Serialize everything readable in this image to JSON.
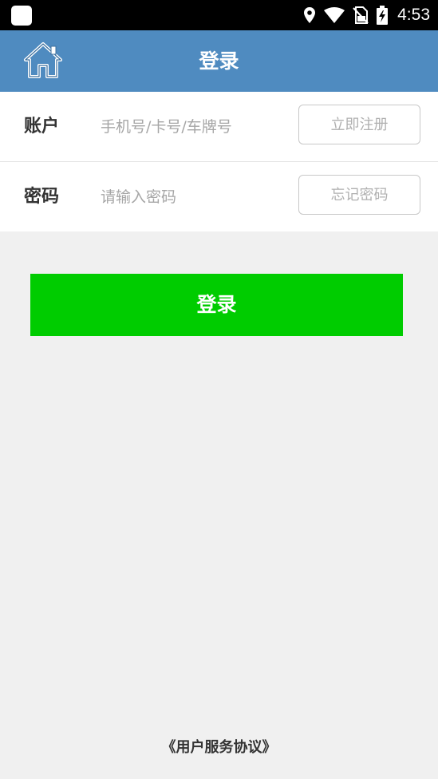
{
  "status_bar": {
    "time": "4:53",
    "icons": [
      "location-icon",
      "wifi-icon",
      "no-sim-icon",
      "battery-charging-icon"
    ]
  },
  "header": {
    "title": "登录",
    "home_icon": "home-icon",
    "background_color": "#4f8bc0"
  },
  "form": {
    "account": {
      "label": "账户",
      "placeholder": "手机号/卡号/车牌号",
      "value": "",
      "action_label": "立即注册"
    },
    "password": {
      "label": "密码",
      "placeholder": "请输入密码",
      "value": "",
      "action_label": "忘记密码"
    }
  },
  "login_button": {
    "label": "登录",
    "color": "#00cc00"
  },
  "footer": {
    "agreement_label": "《用户服务协议》"
  }
}
